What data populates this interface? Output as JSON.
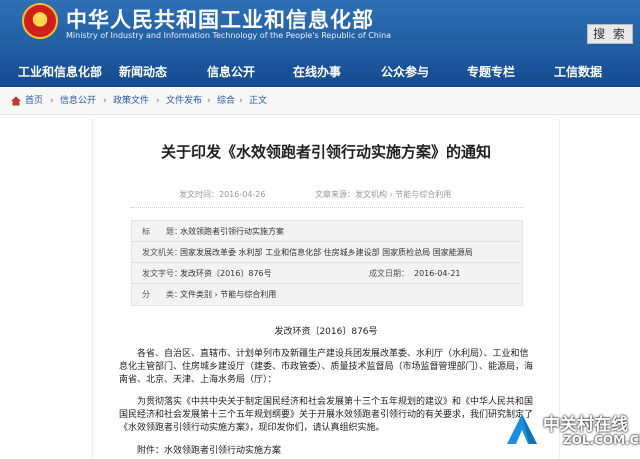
{
  "header": {
    "site_title": "中华人民共和国工业和信息化部",
    "site_subtitle": "Ministry of Industry and Information Technology of the People's Republic of China",
    "search_label": "搜 索"
  },
  "nav": {
    "items": [
      "工业和信息化部",
      "新闻动态",
      "信息公开",
      "在线办事",
      "公众参与",
      "专题专栏",
      "工信数据"
    ]
  },
  "breadcrumb": {
    "items": [
      "首页",
      "信息公开",
      "政策文件",
      "文件发布",
      "综合",
      "正文"
    ],
    "separator": "›"
  },
  "article": {
    "title": "关于印发《水效领跑者引领行动实施方案》的通知",
    "publish_time": "发文时间：2016-04-26",
    "source": "文章来源：发文机构 › 节能与综合利用",
    "info": {
      "title_label": "标　　题：",
      "title_value": "水效领跑者引领行动实施方案",
      "issuer_label": "发文机关：",
      "issuer_value": "国家发展改革委 水利部 工业和信息化部 住房城乡建设部 国家质检总局 国家能源局",
      "doc_no_label": "发文字号：",
      "doc_no_value": "发改环资〔2016〕876号",
      "date_label": "成文日期：",
      "date_value": "2016-04-21",
      "category_label": "分　　类：",
      "category_value": "文件类别 › 节能与综合利用"
    },
    "doc_number": "发改环资〔2016〕876号",
    "para1": "　　各省、自治区、直辖市、计划单列市及新疆生产建设兵团发展改革委、水利厅（水利局）、工业和信息化主管部门、住房城乡建设厅（建委、市政管委）、质量技术监督局（市场监督管理部门）、能源局，海南省、北京、天津、上海水务局（厅）：",
    "para2": "　　为贯彻落实《中共中央关于制定国民经济和社会发展第十三个五年规划的建议》和《中华人民共和国国民经济和社会发展第十三个五年规划纲要》关于开展水效领跑者引领行动的有关要求，我们研究制定了《水效领跑者引领行动实施方案》，现印发你们，请认真组织实施。",
    "attachment": "　　附件：水效领跑者引领行动实施方案"
  },
  "watermark": {
    "main": "中关村在线",
    "sub": "ZOL.COM.CN"
  },
  "colors": {
    "header_blue": "#2f6fb4",
    "nav_blue": "#1d57a0",
    "link_blue": "#2a5aa0"
  }
}
